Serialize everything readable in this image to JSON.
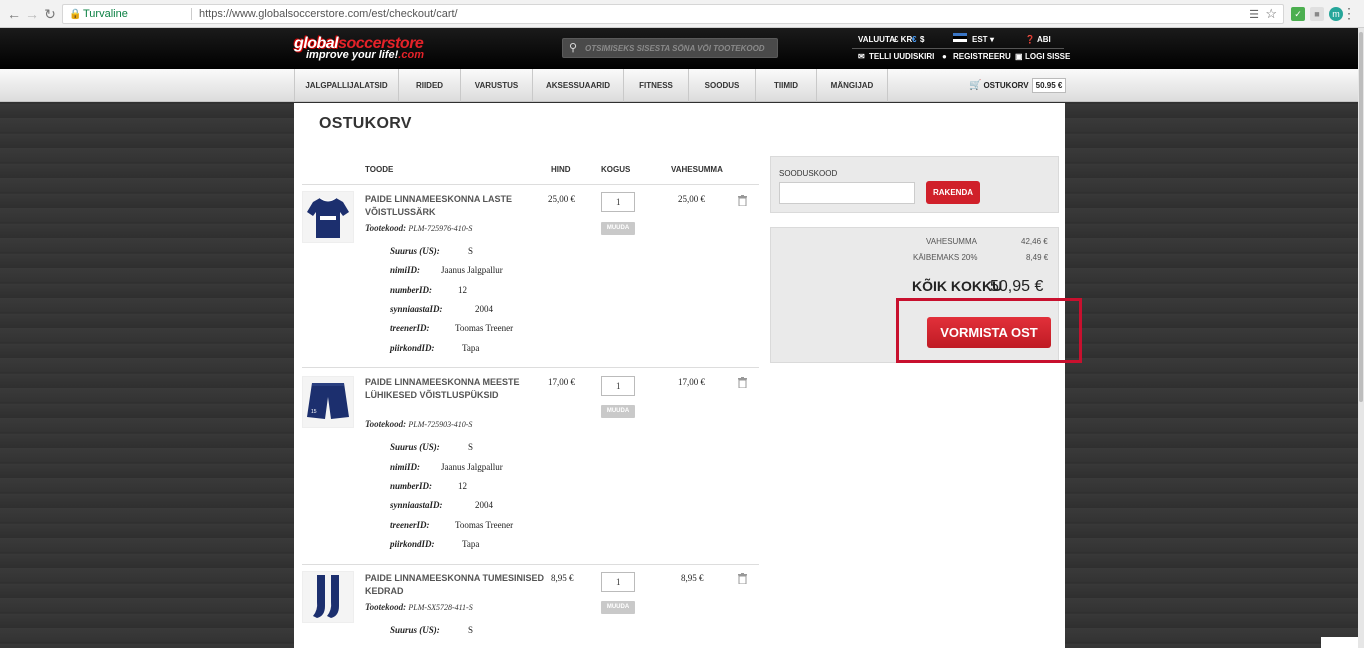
{
  "browser": {
    "secure_label": "Turvaline",
    "url": "https://www.globalsoccerstore.com/est/checkout/cart/"
  },
  "header": {
    "logo_line1_a": "global",
    "logo_line1_b": "soccerstore",
    "logo_line2_a": "improve your life!",
    "logo_line2_b": ".com",
    "search_placeholder": "OTSIMISEKS SISESTA SÕNA VÕI TOOTEKOOD",
    "valuuta_label": "VALUUTA",
    "currencies": "£ KR",
    "currency_active": "€",
    "currency_usd": "$",
    "language": "EST",
    "help": "ABI",
    "newsletter": "TELLI UUDISKIRI",
    "register": "REGISTREERU",
    "login": "LOGI SISSE"
  },
  "nav": {
    "items": [
      "JALGPALLIJALATSID",
      "RIIDED",
      "VARUSTUS",
      "AKSESSUAARID",
      "FITNESS",
      "SOODUS",
      "TIIMID",
      "MÄNGIJAD"
    ],
    "cart_label": "OSTUKORV",
    "cart_amount": "50.95 €"
  },
  "cart": {
    "title": "OSTUKORV",
    "columns": {
      "product": "TOODE",
      "price": "HIND",
      "qty": "KOGUS",
      "subtotal": "VAHESUMMA"
    },
    "code_label": "Tootekood:",
    "update_label": "MUUDA",
    "items": [
      {
        "name": "PAIDE LINNAMEESKONNA LASTE VÕISTLUSSÄRK",
        "code": "PLM-725976-410-S",
        "price": "25,00 €",
        "qty": "1",
        "subtotal": "25,00 €",
        "attrs": [
          {
            "k": "Suurus (US):",
            "v": "S"
          },
          {
            "k": "nimiID:",
            "v": "Jaanus Jalgpallur"
          },
          {
            "k": "numberID:",
            "v": "12"
          },
          {
            "k": "synniaastaID:",
            "v": "2004"
          },
          {
            "k": "treenerID:",
            "v": "Toomas Treener"
          },
          {
            "k": "piirkondID:",
            "v": "Tapa"
          }
        ]
      },
      {
        "name": "PAIDE LINNAMEESKONNA MEESTE LÜHIKESED VÕISTLUSPÜKSID",
        "code": "PLM-725903-410-S",
        "price": "17,00 €",
        "qty": "1",
        "subtotal": "17,00 €",
        "attrs": [
          {
            "k": "Suurus (US):",
            "v": "S"
          },
          {
            "k": "nimiID:",
            "v": "Jaanus Jalgpallur"
          },
          {
            "k": "numberID:",
            "v": "12"
          },
          {
            "k": "synniaastaID:",
            "v": "2004"
          },
          {
            "k": "treenerID:",
            "v": "Toomas Treener"
          },
          {
            "k": "piirkondID:",
            "v": "Tapa"
          }
        ]
      },
      {
        "name": "PAIDE LINNAMEESKONNA TUMESINISED KEDRAD",
        "code": "PLM-SX5728-411-S",
        "price": "8,95 €",
        "qty": "1",
        "subtotal": "8,95 €",
        "attrs": [
          {
            "k": "Suurus (US):",
            "v": "S"
          }
        ]
      }
    ]
  },
  "coupon": {
    "label": "SOODUSKOOD",
    "apply": "RAKENDA"
  },
  "totals": {
    "subtotal_label": "VAHESUMMA",
    "subtotal": "42,46 €",
    "tax_label": "KÄIBEMAKS 20%",
    "tax": "8,49 €",
    "grand_label": "KÕIK KOKKU",
    "grand": "50,95 €",
    "checkout": "VORMISTA OST"
  },
  "colors": {
    "brand_red": "#d0202a",
    "highlight": "#c8102e",
    "jersey_blue": "#1c2f6e"
  }
}
